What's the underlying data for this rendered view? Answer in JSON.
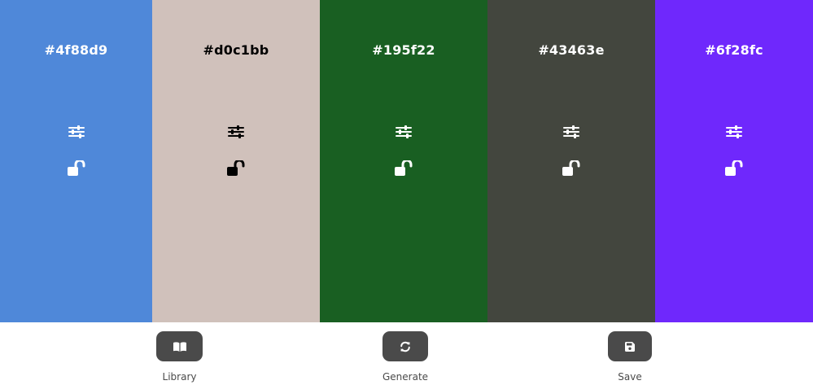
{
  "palette": {
    "colors": [
      {
        "hex": "#4f88d9",
        "background": "#4f88d9",
        "text_color": "#ffffff",
        "adjust_icon": "sliders-icon",
        "lock_icon": "unlock-icon"
      },
      {
        "hex": "#d0c1bb",
        "background": "#d0c1bb",
        "text_color": "#000000",
        "adjust_icon": "sliders-icon",
        "lock_icon": "unlock-icon"
      },
      {
        "hex": "#195f22",
        "background": "#195f22",
        "text_color": "#ffffff",
        "adjust_icon": "sliders-icon",
        "lock_icon": "unlock-icon"
      },
      {
        "hex": "#43463e",
        "background": "#43463e",
        "text_color": "#ffffff",
        "adjust_icon": "sliders-icon",
        "lock_icon": "unlock-icon"
      },
      {
        "hex": "#6f28fc",
        "background": "#6f28fc",
        "text_color": "#ffffff",
        "adjust_icon": "sliders-icon",
        "lock_icon": "unlock-icon"
      }
    ]
  },
  "panel": {
    "button_color": "#4a4a4a",
    "library": {
      "label": "Library",
      "icon": "book-icon"
    },
    "generate": {
      "label": "Generate",
      "icon": "refresh-icon"
    },
    "save": {
      "label": "Save",
      "icon": "save-icon"
    }
  }
}
